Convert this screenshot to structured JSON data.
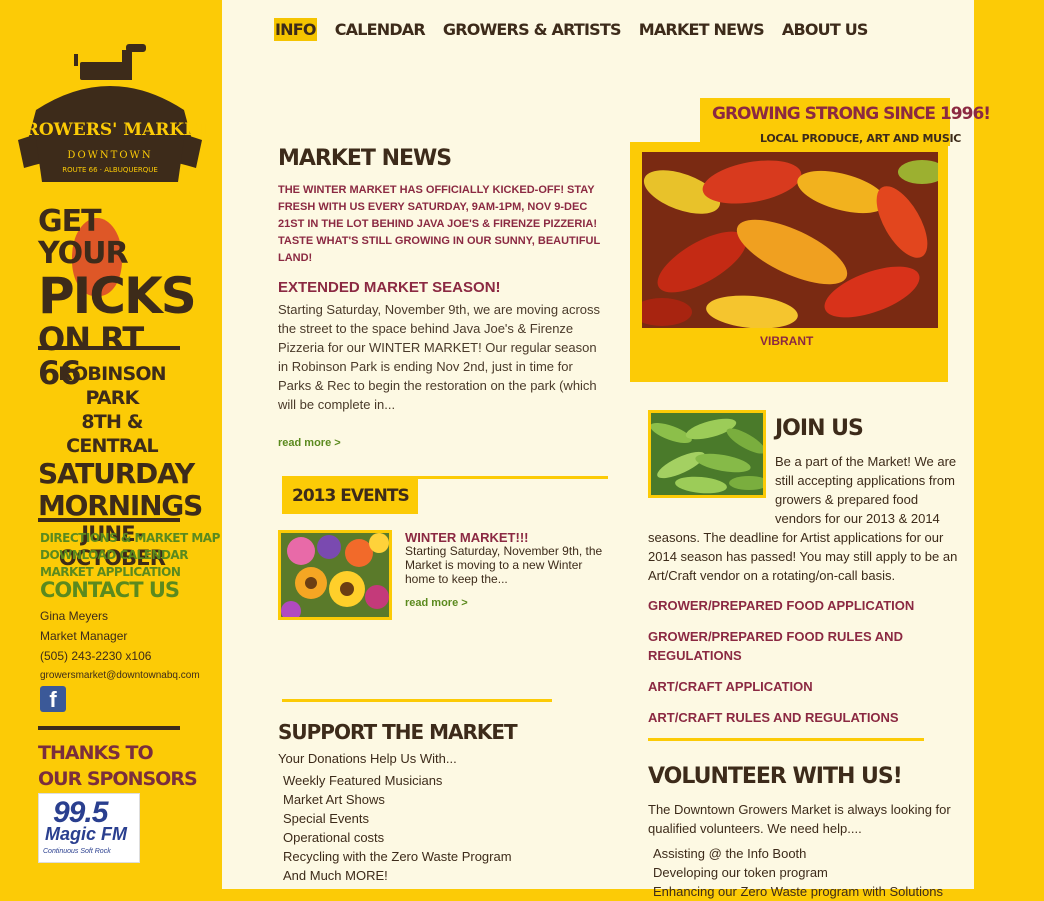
{
  "nav": {
    "items": [
      "INFO",
      "CALENDAR",
      "GROWERS & ARTISTS",
      "MARKET NEWS",
      "ABOUT US"
    ],
    "active": "INFO"
  },
  "logo": {
    "title": "GROWERS' MARKET",
    "line1": "DOWNTOWN",
    "line2": "ROUTE 66 · ALBUQUERQUE"
  },
  "sidebar": {
    "picks": {
      "line1": "GET YOUR",
      "line2": "PICKS",
      "line3": "ON RT 66"
    },
    "schedule": {
      "place": "ROBINSON PARK",
      "address": "8TH & CENTRAL",
      "day": "SATURDAY",
      "time": "MORNINGS",
      "season": "JUNE-OCTOBER"
    },
    "links": [
      "DIRECTIONS & MARKET MAP",
      "DOWNLOAD CALENDAR",
      "MARKET APPLICATION"
    ],
    "contact_title": "CONTACT US",
    "contact": {
      "name": "Gina Meyers",
      "role": "Market Manager",
      "phone": "(505) 243-2230 x106",
      "email": "growersmarket@downtownabq.com"
    },
    "facebook_glyph": "f",
    "thanks": {
      "line1": "THANKS TO",
      "line2": "OUR SPONSORS"
    },
    "sponsor": {
      "number": "99.5",
      "name": "Magic FM",
      "tagline": "Continuous Soft Rock"
    }
  },
  "market_news": {
    "title": "MARKET NEWS",
    "intro": "THE WINTER MARKET HAS OFFICIALLY KICKED-OFF! STAY FRESH WITH US EVERY SATURDAY, 9AM-1PM, NOV 9-DEC 21ST IN THE LOT BEHIND JAVA JOE'S & FIRENZE PIZZERIA! TASTE WHAT'S STILL GROWING IN OUR SUNNY, BEAUTIFUL LAND!",
    "article_title": "EXTENDED MARKET SEASON!",
    "article_body": "Starting Saturday, November 9th, we are moving across the street to the space behind Java Joe's & Firenze Pizzeria for our WINTER MARKET!  Our regular season in Robinson Park is ending Nov 2nd, just in time for Parks & Rec to begin the restoration on the park (which will be complete in...",
    "read_more": "read more >"
  },
  "events": {
    "title": "2013 EVENTS",
    "item_title": "WINTER MARKET!!!",
    "item_body": "Starting Saturday, November 9th, the Market is moving to a new Winter home to keep the...",
    "read_more": "read more >"
  },
  "support": {
    "title": "SUPPORT THE MARKET",
    "subtitle": "Your Donations Help Us With...",
    "items": [
      "Weekly Featured Musicians",
      "Market Art Shows",
      "Special Events",
      "Operational costs",
      "Recycling with the Zero Waste Program",
      "And Much MORE!"
    ]
  },
  "growing": {
    "title": "GROWING STRONG SINCE 1996!",
    "subtitle": "LOCAL PRODUCE, ART AND MUSIC",
    "caption": "VIBRANT"
  },
  "join": {
    "title": "JOIN US",
    "body1": "Be a part of the Market! We are still accepting applications from growers & prepared food vendors for our 2013 & 2014",
    "body2": "seasons. The deadline for Artist applications for our 2014 season has passed! You may still apply to be an Art/Craft vendor on a rotating/on-call basis.",
    "links": [
      "GROWER/PREPARED FOOD APPLICATION",
      "GROWER/PREPARED FOOD RULES AND REGULATIONS",
      "ART/CRAFT APPLICATION",
      "ART/CRAFT RULES AND REGULATIONS"
    ]
  },
  "volunteer": {
    "title": "VOLUNTEER WITH US!",
    "body": "The Downtown Growers Market is always looking for qualified volunteers. We need help....",
    "items": [
      "Assisting @ the Info Booth",
      "Developing our token program",
      "Enhancing our Zero Waste program with Solutions"
    ]
  },
  "colors": {
    "yellow": "#fccb06",
    "cream": "#fdf9e3",
    "brown": "#3d2b1a",
    "maroon": "#8b2942",
    "green": "#5b8a1e"
  }
}
